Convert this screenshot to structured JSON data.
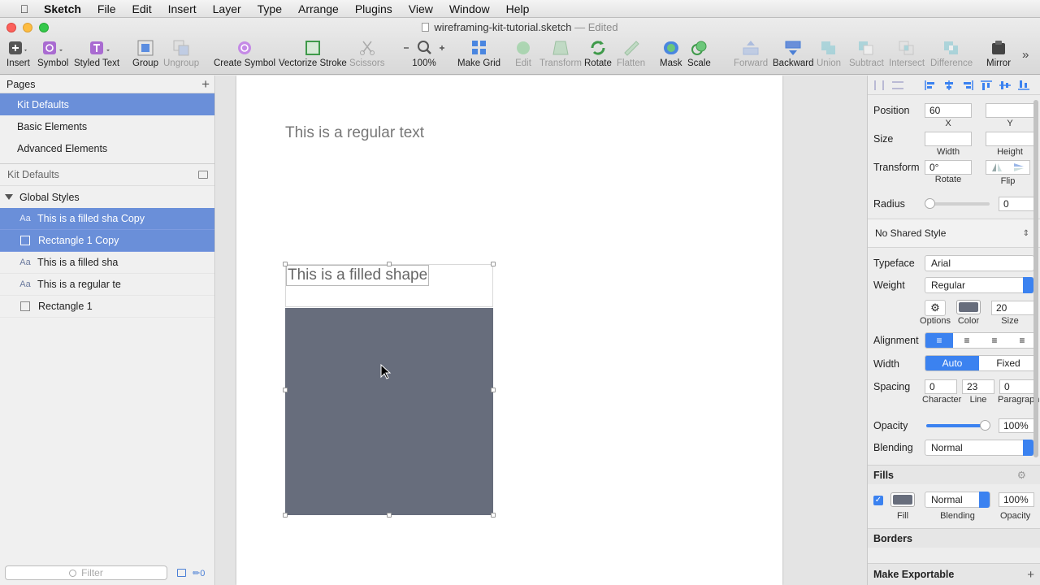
{
  "menubar": {
    "app": "Sketch",
    "items": [
      "File",
      "Edit",
      "Insert",
      "Layer",
      "Type",
      "Arrange",
      "Plugins",
      "View",
      "Window",
      "Help"
    ]
  },
  "window": {
    "title": "wireframing-kit-tutorial.sketch",
    "status": "— Edited"
  },
  "toolbar": {
    "insert": "Insert",
    "symbol": "Symbol",
    "styled_text": "Styled Text",
    "group": "Group",
    "ungroup": "Ungroup",
    "create_symbol": "Create Symbol",
    "vectorize_stroke": "Vectorize Stroke",
    "scissors": "Scissors",
    "zoom": "100%",
    "make_grid": "Make Grid",
    "edit": "Edit",
    "transform": "Transform",
    "rotate": "Rotate",
    "flatten": "Flatten",
    "mask": "Mask",
    "scale": "Scale",
    "forward": "Forward",
    "backward": "Backward",
    "union": "Union",
    "subtract": "Subtract",
    "intersect": "Intersect",
    "difference": "Difference",
    "mirror": "Mirror"
  },
  "pages": {
    "header": "Pages",
    "items": [
      "Kit Defaults",
      "Basic Elements",
      "Advanced Elements"
    ]
  },
  "layers": {
    "header": "Kit Defaults",
    "group": "Global Styles",
    "text_icon": "Aa",
    "items": [
      "This is a filled sha Copy",
      "Rectangle 1 Copy",
      "This is a filled sha",
      "This is a regular te",
      "Rectangle 1"
    ]
  },
  "filter": {
    "placeholder": "Filter",
    "count": "0"
  },
  "canvas": {
    "regular_text": "This is a regular text",
    "filled_text": "This is a filled shape",
    "shape_color": "#676d7c"
  },
  "inspector": {
    "position_label": "Position",
    "x_value": "60",
    "x_label": "X",
    "y_value": "",
    "y_label": "Y",
    "size_label": "Size",
    "width_value": "",
    "width_label": "Width",
    "height_value": "",
    "height_label": "Height",
    "transform_label": "Transform",
    "rotate_value": "0°",
    "rotate_label": "Rotate",
    "flip_label": "Flip",
    "radius_label": "Radius",
    "radius_value": "0",
    "shared_style": "No Shared Style",
    "typeface_label": "Typeface",
    "typeface_value": "Arial",
    "weight_label": "Weight",
    "weight_value": "Regular",
    "options_label": "Options",
    "color_label": "Color",
    "size_value": "20",
    "size_sub": "Size",
    "alignment_label": "Alignment",
    "width_label2": "Width",
    "auto": "Auto",
    "fixed": "Fixed",
    "spacing_label": "Spacing",
    "char_value": "0",
    "char_label": "Character",
    "line_value": "23",
    "line_label": "Line",
    "para_value": "0",
    "para_label": "Paragraph",
    "opacity_label": "Opacity",
    "opacity_value": "100%",
    "opacity_level": 1.0,
    "blending_label": "Blending",
    "blending_value": "Normal",
    "fills_header": "Fills",
    "fill_label": "Fill",
    "fill_blend": "Normal",
    "fill_blend_label": "Blending",
    "fill_opacity": "100%",
    "fill_opacity_label": "Opacity",
    "borders_header": "Borders",
    "export_header": "Make Exportable",
    "accent": "#3b82f0"
  }
}
